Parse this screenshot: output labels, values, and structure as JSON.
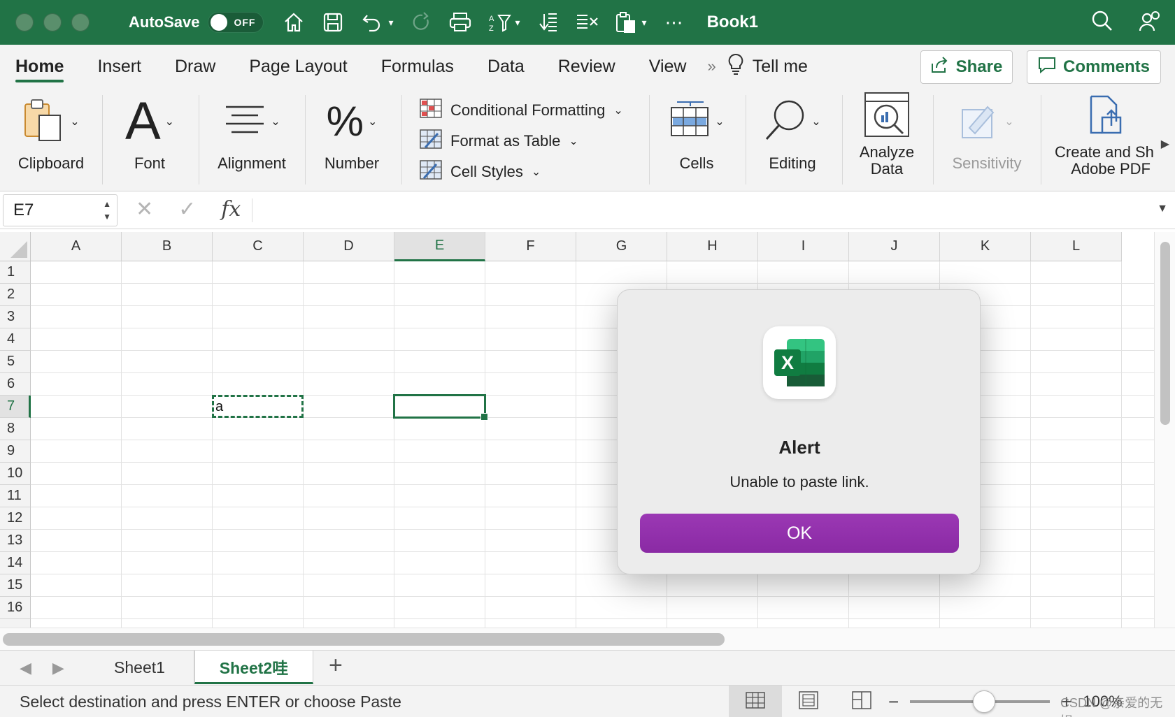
{
  "titlebar": {
    "autosave_label": "AutoSave",
    "autosave_state": "OFF",
    "doc_title": "Book1"
  },
  "tabs": [
    "Home",
    "Insert",
    "Draw",
    "Page Layout",
    "Formulas",
    "Data",
    "Review",
    "View"
  ],
  "tellme": "Tell me",
  "share_label": "Share",
  "comments_label": "Comments",
  "ribbon": {
    "clipboard": "Clipboard",
    "font": "Font",
    "alignment": "Alignment",
    "number": "Number",
    "conditional_formatting": "Conditional Formatting",
    "format_as_table": "Format as Table",
    "cell_styles": "Cell Styles",
    "cells": "Cells",
    "editing": "Editing",
    "analyze_line1": "Analyze",
    "analyze_line2": "Data",
    "sensitivity": "Sensitivity",
    "pdf_line1": "Create and Sh",
    "pdf_line2": "Adobe PDF"
  },
  "formula_bar": {
    "name_box": "E7",
    "fx": "fx"
  },
  "columns": [
    "A",
    "B",
    "C",
    "D",
    "E",
    "F",
    "G",
    "H",
    "I",
    "J",
    "K",
    "L"
  ],
  "rows": [
    "1",
    "2",
    "3",
    "4",
    "5",
    "6",
    "7",
    "8",
    "9",
    "10",
    "11",
    "12",
    "13",
    "14",
    "15",
    "16"
  ],
  "selected_cell": {
    "column": "E",
    "row": "7"
  },
  "copied_cell": {
    "column": "C",
    "row": "7",
    "value": "a"
  },
  "sheets": [
    "Sheet1",
    "Sheet2哇"
  ],
  "active_sheet": "Sheet2哇",
  "status": {
    "message": "Select destination and press ENTER or choose Paste",
    "zoom": "100%"
  },
  "dialog": {
    "title": "Alert",
    "message": "Unable to paste link.",
    "ok_label": "OK"
  },
  "watermark": "CSDN @亲爱的无媞",
  "colors": {
    "excel_green": "#217346",
    "ok_purple": "#8a2aa4"
  }
}
